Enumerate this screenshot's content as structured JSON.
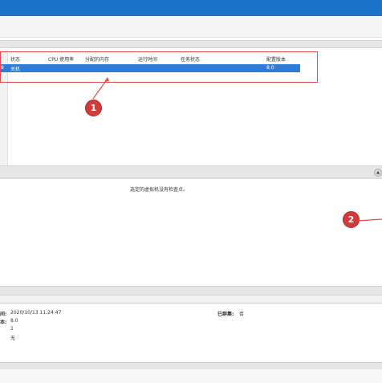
{
  "vm_table": {
    "columns": [
      "状态",
      "CPU 使用率",
      "分配的内存",
      "运行时间",
      "任务状态",
      "配置版本"
    ],
    "selected_row": {
      "id_fragment": "8",
      "state": "关机",
      "config_version": "8.0"
    }
  },
  "checkpoints": {
    "empty_message": "选定的虚拟机没有检查点。"
  },
  "details": {
    "created_label_fragment": "间:",
    "created_value": "2020/10/13 11:24:47",
    "version_label_fragment": "本:",
    "version_value": "8.0",
    "generation_value": "1",
    "notes_value": "无",
    "clustered_label": "已群集:",
    "clustered_value": "否"
  },
  "annotations": {
    "callout_1": "1",
    "callout_2": "2",
    "accent_red": "#e24b4b",
    "selection_blue": "#2f7bd8"
  },
  "icons": {
    "scroll_up": "chevron-up-icon"
  }
}
